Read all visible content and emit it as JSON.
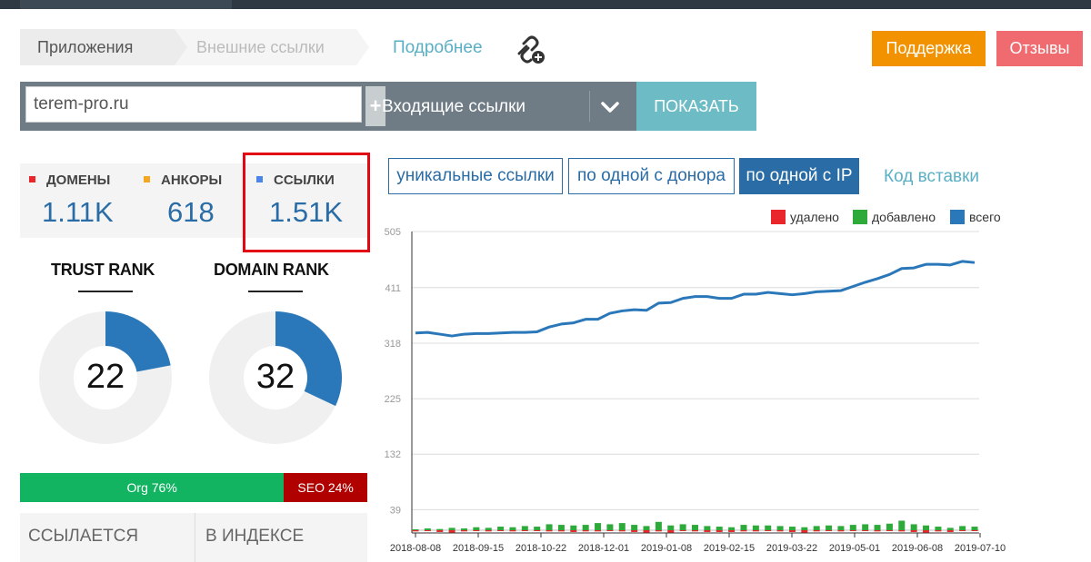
{
  "breadcrumb": {
    "item1": "Приложения",
    "item2": "Внешние ссылки"
  },
  "header": {
    "more_link": "Подробнее",
    "support_label": "Поддержка",
    "reviews_label": "Отзывы"
  },
  "search": {
    "domain_value": "terem-pro.ru",
    "plus_label": "+",
    "select_value": "Входящие ссылки",
    "show_label": "ПОКАЗАТЬ"
  },
  "stats": {
    "domains": {
      "label": "ДОМЕНЫ",
      "value": "1.11K",
      "color": "#e8262b"
    },
    "anchors": {
      "label": "АНКОРЫ",
      "value": "618",
      "color": "#f5a623"
    },
    "links": {
      "label": "ССЫЛКИ",
      "value": "1.51K",
      "color": "#4a86e8"
    }
  },
  "ranks": {
    "trust": {
      "title": "TRUST RANK",
      "value": "22",
      "fraction": 0.22
    },
    "domain": {
      "title": "DOMAIN RANK",
      "value": "32",
      "fraction": 0.32
    }
  },
  "traffic_split": {
    "org_label": "Org 76%",
    "org_fraction": 0.76,
    "seo_label": "SEO 24%",
    "seo_fraction": 0.24
  },
  "bottom_tabs": {
    "tab1": "ССЫЛАЕТСЯ",
    "tab2": "В ИНДЕКСЕ"
  },
  "filter_tabs": [
    {
      "label": "уникальные ссылки",
      "active": false
    },
    {
      "label": "по одной с донора",
      "active": false
    },
    {
      "label": "по одной с IP",
      "active": true
    }
  ],
  "code_link": "Код вставки",
  "colors": {
    "removed": "#e8262b",
    "added": "#2eaa3b",
    "total": "#2a78b9",
    "accent": "#2a6ca6"
  },
  "chart_data": {
    "type": "line",
    "legend": [
      {
        "name": "удалено",
        "color": "#e8262b"
      },
      {
        "name": "добавлено",
        "color": "#2eaa3b"
      },
      {
        "name": "всего",
        "color": "#2a78b9"
      }
    ],
    "legend_position": "top-right",
    "y_ticks": [
      505,
      411,
      318,
      225,
      132,
      39
    ],
    "ylim": [
      0,
      505
    ],
    "x_ticks": [
      "2018-08-08",
      "2018-09-15",
      "2018-10-22",
      "2018-12-01",
      "2019-01-08",
      "2019-02-15",
      "2019-03-22",
      "2019-05-01",
      "2019-06-08",
      "2019-07-10"
    ],
    "grid": true,
    "series": [
      {
        "name": "всего",
        "values": [
          335,
          336,
          333,
          330,
          333,
          334,
          334,
          335,
          336,
          336,
          337,
          345,
          350,
          352,
          358,
          358,
          368,
          372,
          374,
          373,
          385,
          386,
          393,
          396,
          396,
          393,
          393,
          400,
          400,
          403,
          401,
          399,
          401,
          404,
          405,
          406,
          413,
          420,
          426,
          433,
          443,
          444,
          450,
          450,
          449,
          455,
          453
        ]
      },
      {
        "name": "добавлено",
        "values": [
          1,
          3,
          2,
          4,
          3,
          5,
          4,
          6,
          5,
          7,
          6,
          10,
          9,
          8,
          9,
          12,
          10,
          12,
          9,
          7,
          14,
          8,
          10,
          9,
          7,
          6,
          5,
          9,
          8,
          8,
          7,
          6,
          5,
          7,
          8,
          7,
          9,
          10,
          9,
          11,
          16,
          10,
          8,
          6,
          4,
          7,
          6
        ]
      },
      {
        "name": "удалено",
        "values": [
          -2,
          -1,
          -3,
          -4,
          -2,
          -1,
          -2,
          -1,
          -2,
          -1,
          -1,
          -2,
          -2,
          -3,
          -2,
          -2,
          -1,
          -2,
          -3,
          -4,
          -2,
          -4,
          -1,
          -2,
          -3,
          -3,
          -3,
          -2,
          -2,
          -1,
          -2,
          -3,
          -4,
          -2,
          -1,
          -2,
          -1,
          -1,
          -2,
          -1,
          -2,
          -3,
          -4,
          -2,
          -3,
          -1,
          -1
        ]
      }
    ]
  }
}
